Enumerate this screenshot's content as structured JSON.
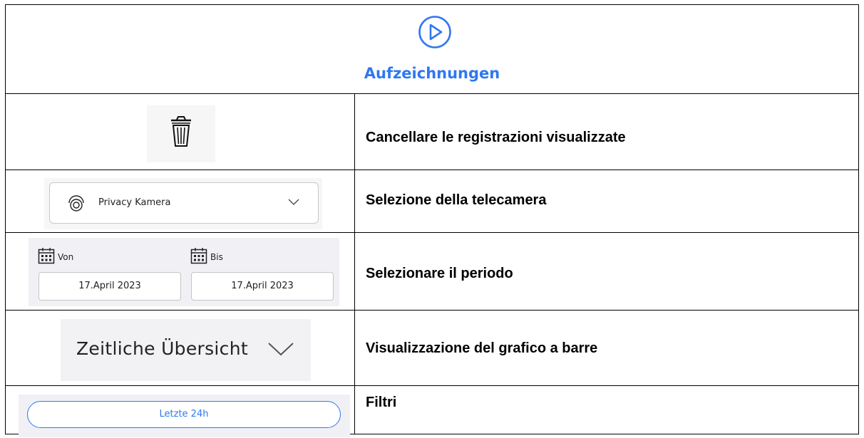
{
  "header": {
    "icon": "play-circle-icon",
    "title": "Aufzeichnungen",
    "accent_color": "#2f78f0"
  },
  "rows": [
    {
      "icon": "trash-icon",
      "description": "Cancellare le registrazioni visualizzate"
    },
    {
      "camera_select": {
        "icon": "camera-icon",
        "value": "Privacy Kamera"
      },
      "description": "Selezione della telecamera"
    },
    {
      "period": {
        "from_label": "Von",
        "from_value": "17.April 2023",
        "to_label": "Bis",
        "to_value": "17.April 2023"
      },
      "description": "Selezionare il periodo"
    },
    {
      "overview_label": "Zeitliche Übersicht",
      "description": "Visualizzazione del grafico a barre"
    },
    {
      "filter_label": "Letzte 24h",
      "description": "Filtri"
    }
  ]
}
